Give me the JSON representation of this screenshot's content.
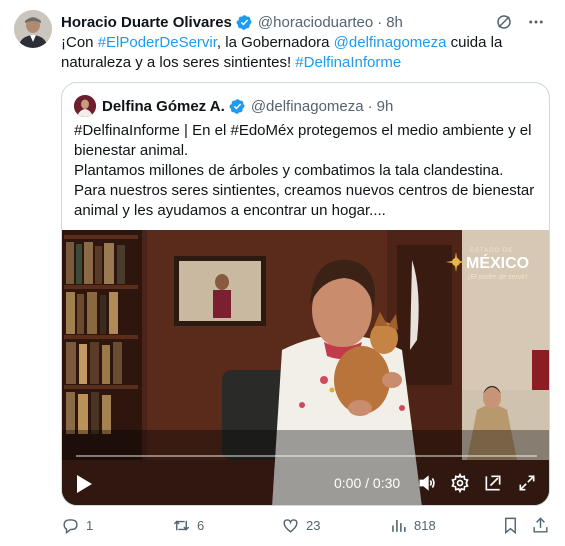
{
  "tweet": {
    "author_name": "Horacio Duarte Olivares",
    "handle": "@horacioduarteo",
    "separator": "·",
    "time": "8h",
    "text_parts": [
      "¡Con ",
      "#ElPoderDeServir",
      ", la Gobernadora ",
      "@delfinagomeza",
      " cuida la naturaleza y a los seres sintientes! ",
      "#DelfinaInforme"
    ]
  },
  "quote": {
    "author_name": "Delfina Gómez A.",
    "handle": "@delfinagomeza",
    "separator": "·",
    "time": "9h",
    "lines": [
      "#DelfinaInforme | En el #EdoMéx protegemos el medio ambiente y el bienestar animal.",
      "Plantamos millones de árboles y combatimos la tala clandestina.",
      "Para nuestros seres sintientes, creamos nuevos centros de bienestar animal y les ayudamos a encontrar un hogar...."
    ]
  },
  "video": {
    "time_display": "0:00 / 0:30",
    "logo_top": "ESTADO DE",
    "logo_main": "MÉXICO",
    "logo_sub": "¡El poder de servir!",
    "progress": 0
  },
  "actions": {
    "replies": "1",
    "reposts": "6",
    "likes": "23",
    "views": "818"
  },
  "colors": {
    "accent": "#1d9bf0",
    "muted": "#536471",
    "text": "#0f1419",
    "border": "#cfd9de"
  },
  "icons": [
    "verified-badge-icon",
    "grok-icon",
    "more-icon",
    "play-icon",
    "volume-icon",
    "settings-icon",
    "pip-icon",
    "fullscreen-icon",
    "reply-icon",
    "repost-icon",
    "like-icon",
    "views-icon",
    "bookmark-icon",
    "share-icon"
  ]
}
